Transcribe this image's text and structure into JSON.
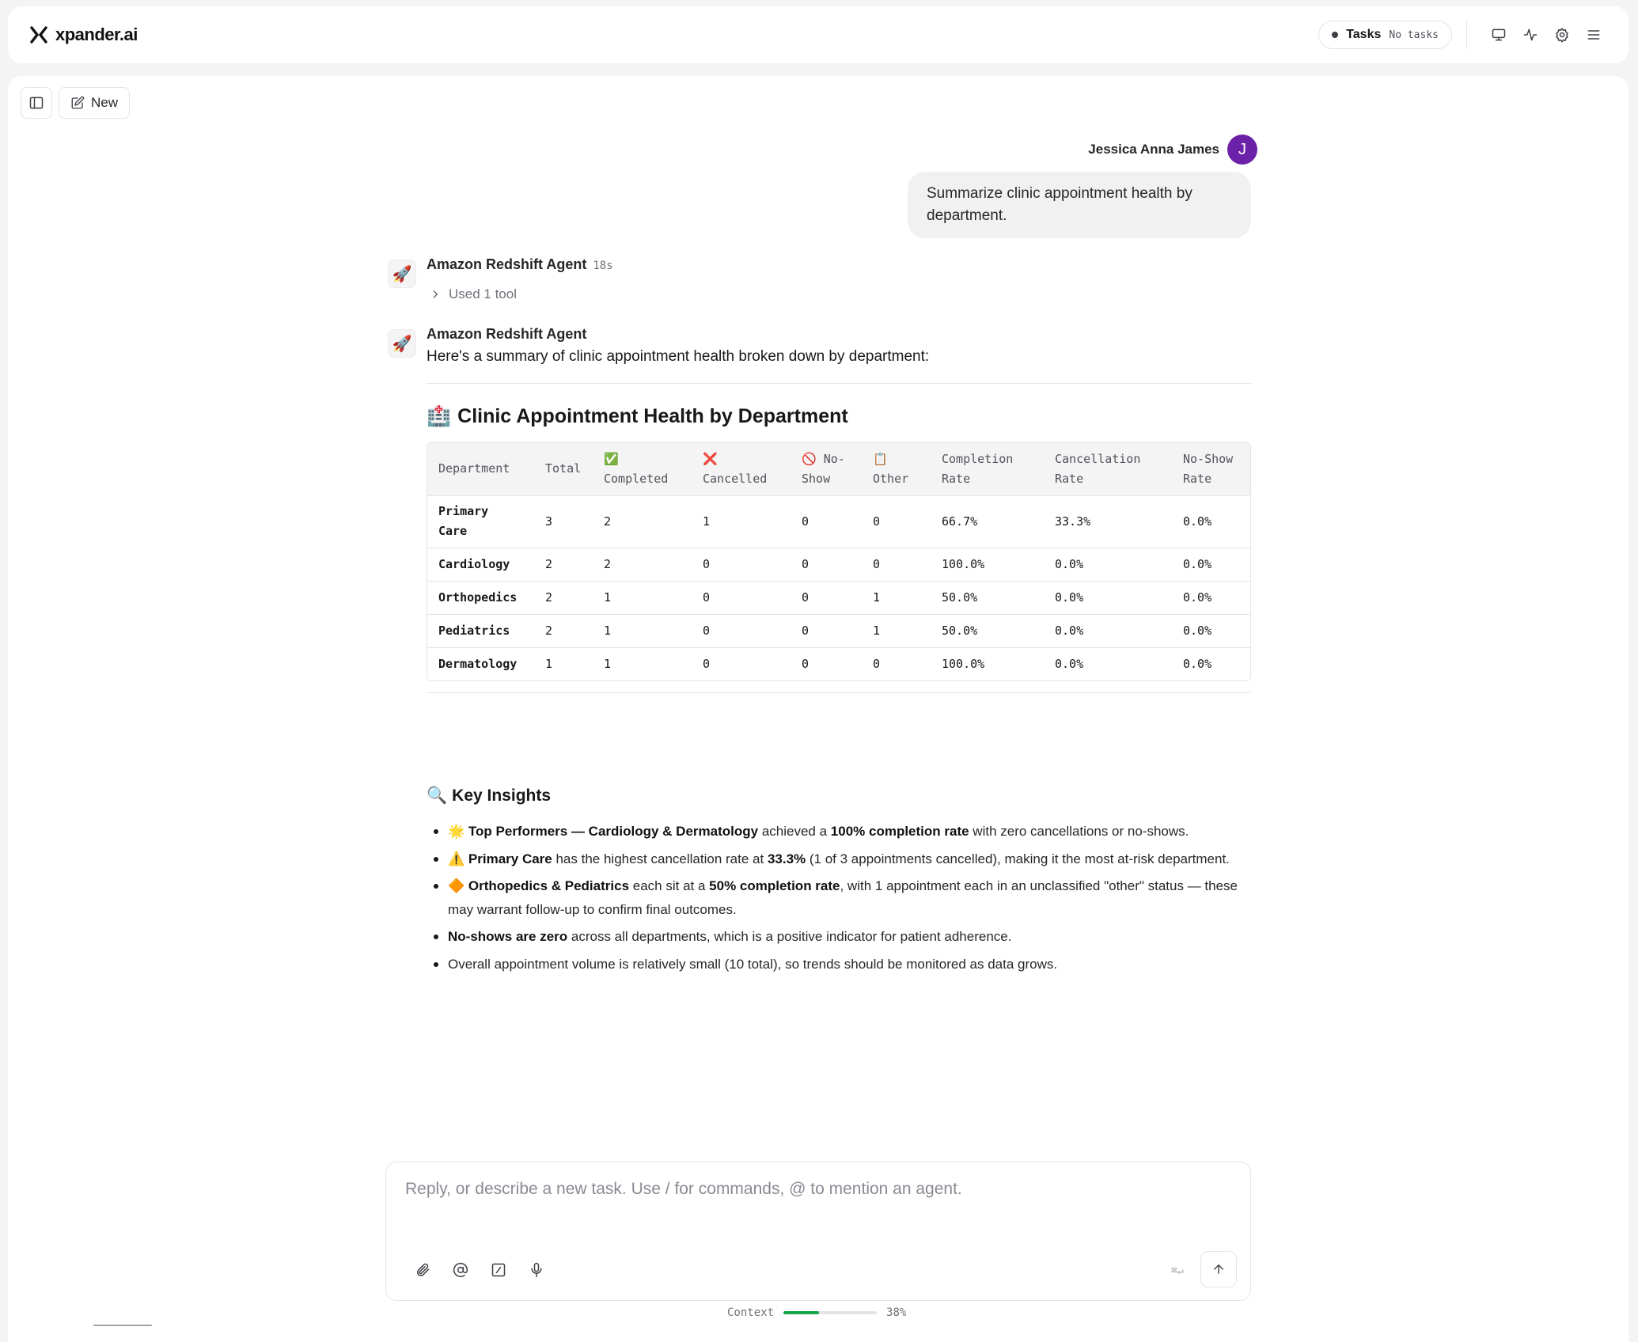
{
  "topbar": {
    "brand": "xpander.ai",
    "tasks_label": "Tasks",
    "tasks_status": "No tasks",
    "icons": [
      "monitor-icon",
      "activity-icon",
      "settings-icon",
      "menu-icon"
    ]
  },
  "toolbar": {
    "new_label": "New"
  },
  "user": {
    "name": "Jessica Anna James",
    "initial": "J",
    "avatar_color": "#6b21a8",
    "message": "Summarize clinic appointment health by department."
  },
  "agent": {
    "name": "Amazon Redshift Agent",
    "elapsed": "18s",
    "tool_summary": "Used 1 tool",
    "intro": "Here's a summary of clinic appointment health broken down by department:",
    "heading": "Clinic Appointment Health by Department",
    "heading_emoji": "🏥",
    "table": {
      "headers": [
        "Department",
        "Total",
        "✅ Completed",
        "❌ Cancelled",
        "🚫 No-Show",
        "📋 Other",
        "Completion Rate",
        "Cancellation Rate",
        "No-Show Rate"
      ],
      "rows": [
        [
          "Primary Care",
          "3",
          "2",
          "1",
          "0",
          "0",
          "66.7%",
          "33.3%",
          "0.0%"
        ],
        [
          "Cardiology",
          "2",
          "2",
          "0",
          "0",
          "0",
          "100.0%",
          "0.0%",
          "0.0%"
        ],
        [
          "Orthopedics",
          "2",
          "1",
          "0",
          "0",
          "1",
          "50.0%",
          "0.0%",
          "0.0%"
        ],
        [
          "Pediatrics",
          "2",
          "1",
          "0",
          "0",
          "1",
          "50.0%",
          "0.0%",
          "0.0%"
        ],
        [
          "Dermatology",
          "1",
          "1",
          "0",
          "0",
          "0",
          "100.0%",
          "0.0%",
          "0.0%"
        ]
      ]
    },
    "insights_heading": "Key Insights",
    "insights_emoji": "🔍",
    "insights": [
      {
        "emoji": "🌟",
        "bold": "Top Performers — Cardiology & Dermatology",
        "text1": " achieved a ",
        "bold2": "100% completion rate",
        "text2": " with zero cancellations or no-shows."
      },
      {
        "emoji": "⚠️",
        "bold": "Primary Care",
        "text1": " has the highest cancellation rate at ",
        "bold2": "33.3%",
        "text2": " (1 of 3 appointments cancelled), making it the most at-risk department."
      },
      {
        "emoji": "🔶",
        "bold": "Orthopedics & Pediatrics",
        "text1": " each sit at a ",
        "bold2": "50% completion rate",
        "text2": ", with 1 appointment each in an unclassified \"other\" status — these may warrant follow-up to confirm final outcomes."
      },
      {
        "emoji": "",
        "bold": "No-shows are zero",
        "text1": " across all departments, which is a positive indicator for patient adherence.",
        "bold2": "",
        "text2": ""
      },
      {
        "emoji": "",
        "bold": "",
        "text1": "Overall appointment volume is relatively small (10 total), so trends should be monitored as data grows.",
        "bold2": "",
        "text2": ""
      }
    ]
  },
  "composer": {
    "placeholder": "Reply, or describe a new task. Use / for commands, @ to mention an agent.",
    "shortcut": "⌘↵",
    "tools": [
      "paperclip-icon",
      "at-sign-icon",
      "slash-command-icon",
      "microphone-icon"
    ]
  },
  "context": {
    "label": "Context",
    "percent_text": "38%",
    "percent": 0.38,
    "bar_color": "#16a34a"
  }
}
